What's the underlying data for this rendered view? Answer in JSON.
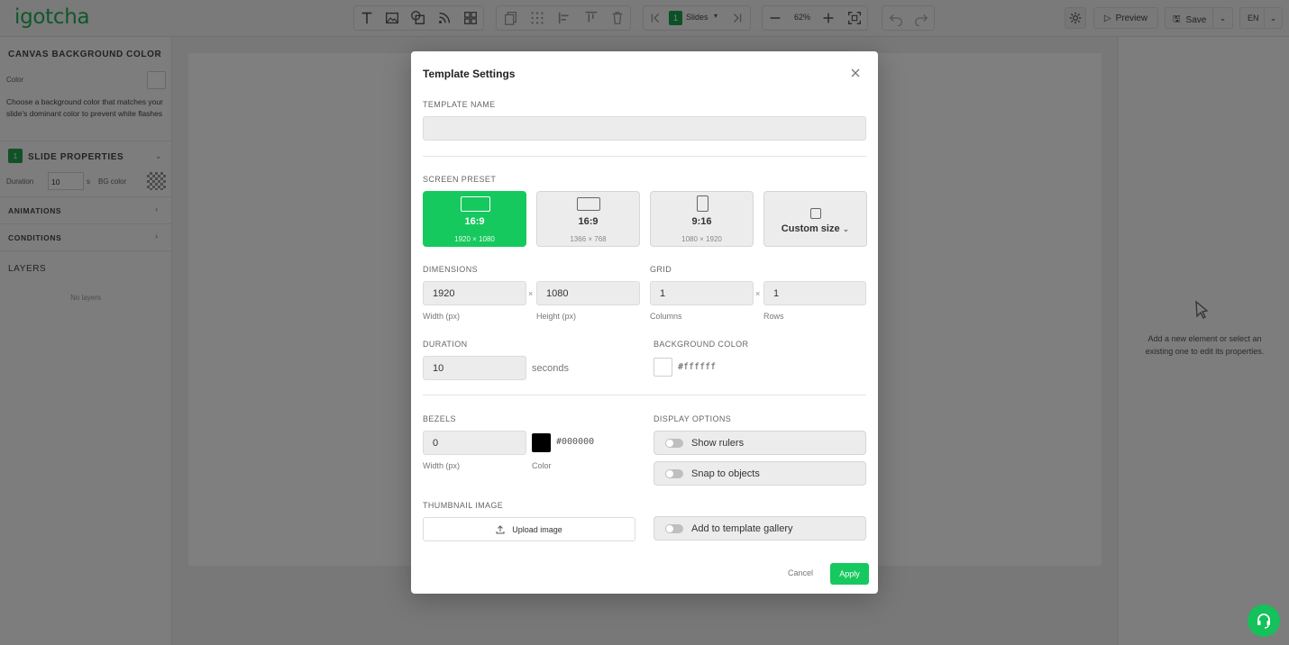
{
  "app": {
    "logo": "igotcha"
  },
  "toolbar": {
    "slide_number": "1",
    "slides_label": "Slides",
    "zoom": "62%",
    "preview_label": "Preview",
    "save_label": "Save",
    "language": "EN",
    "icons": [
      "text-icon",
      "image-icon",
      "shapes-icon",
      "rss-icon",
      "widgets-icon",
      "duplicate-icon",
      "grid-dots-icon",
      "align-left-icon",
      "align-top-icon",
      "delete-icon",
      "first-slide-icon",
      "last-slide-icon",
      "zoom-out-icon",
      "zoom-in-icon",
      "fit-screen-icon",
      "undo-icon",
      "redo-icon",
      "settings-icon"
    ]
  },
  "sidebar": {
    "canvas_bg": {
      "title": "CANVAS BACKGROUND COLOR",
      "color_label": "Color",
      "description": "Choose a background color that matches your slide's dominant color to prevent white flashes"
    },
    "slide_properties": {
      "number": "1",
      "title": "SLIDE PROPERTIES",
      "duration_label": "Duration",
      "duration_value": "10",
      "duration_unit": "s",
      "bg_color_label": "BG color"
    },
    "animations_title": "ANIMATIONS",
    "conditions_title": "CONDITIONS",
    "layers_title": "LAYERS",
    "layers_empty": "No layers"
  },
  "right_panel": {
    "message": "Add a new element or select an existing one to edit its properties."
  },
  "modal": {
    "title": "Template Settings",
    "template_name_label": "TEMPLATE NAME",
    "template_name_value": "",
    "screen_preset_label": "SCREEN PRESET",
    "presets": [
      {
        "ratio": "16:9",
        "dims": "1920 × 1080",
        "active": true
      },
      {
        "ratio": "16:9",
        "dims": "1366 × 768",
        "active": false
      },
      {
        "ratio": "9:16",
        "dims": "1080 × 1920",
        "active": false
      },
      {
        "ratio": "Custom size",
        "dims": "",
        "active": false
      }
    ],
    "dimensions": {
      "label": "DIMENSIONS",
      "width": "1920",
      "height": "1080",
      "width_caption": "Width (px)",
      "height_caption": "Height (px)"
    },
    "grid": {
      "label": "GRID",
      "columns": "1",
      "rows": "1",
      "columns_caption": "Columns",
      "rows_caption": "Rows"
    },
    "duration": {
      "label": "DURATION",
      "value": "10",
      "unit": "seconds"
    },
    "background_color": {
      "label": "BACKGROUND COLOR",
      "value": "#ffffff"
    },
    "bezels": {
      "label": "BEZELS",
      "width": "0",
      "width_caption": "Width (px)",
      "color": "#000000",
      "color_caption": "Color"
    },
    "display_options": {
      "label": "DISPLAY OPTIONS",
      "show_rulers": "Show rulers",
      "snap_to_objects": "Snap to objects"
    },
    "thumbnail": {
      "label": "THUMBNAIL IMAGE",
      "upload_label": "Upload image"
    },
    "gallery_toggle": "Add to template gallery",
    "cancel_label": "Cancel",
    "apply_label": "Apply"
  },
  "colors": {
    "brand_green": "#16c95e",
    "overlay": "rgba(0,0,0,0.5)"
  }
}
